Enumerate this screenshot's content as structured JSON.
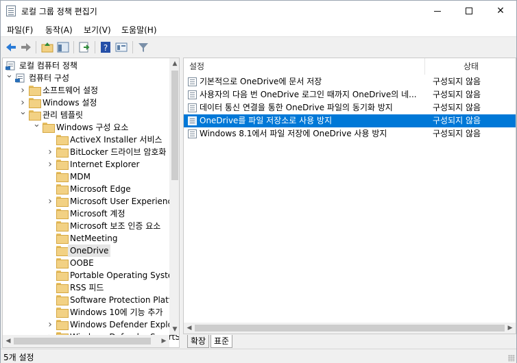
{
  "window": {
    "title": "로컬 그룹 정책 편집기"
  },
  "menu": [
    "파일(F)",
    "동작(A)",
    "보기(V)",
    "도움말(H)"
  ],
  "tree": [
    {
      "label": "로컬 컴퓨터 정책",
      "level": 0,
      "expander": "",
      "icon": "computer-policy-icon"
    },
    {
      "label": "컴퓨터 구성",
      "level": 1,
      "expander": "down",
      "icon": "computer-icon"
    },
    {
      "label": "소프트웨어 설정",
      "level": 2,
      "expander": "right",
      "icon": "folder-icon"
    },
    {
      "label": "Windows 설정",
      "level": 2,
      "expander": "right",
      "icon": "folder-icon"
    },
    {
      "label": "관리 템플릿",
      "level": 2,
      "expander": "down",
      "icon": "folder-icon"
    },
    {
      "label": "Windows 구성 요소",
      "level": 3,
      "expander": "down",
      "icon": "folder-icon"
    },
    {
      "label": "ActiveX Installer 서비스",
      "level": 4,
      "expander": "",
      "icon": "folder-icon"
    },
    {
      "label": "BitLocker 드라이브 암호화",
      "level": 4,
      "expander": "right",
      "icon": "folder-icon"
    },
    {
      "label": "Internet Explorer",
      "level": 4,
      "expander": "right",
      "icon": "folder-icon"
    },
    {
      "label": "MDM",
      "level": 4,
      "expander": "",
      "icon": "folder-icon"
    },
    {
      "label": "Microsoft Edge",
      "level": 4,
      "expander": "",
      "icon": "folder-icon"
    },
    {
      "label": "Microsoft User Experience",
      "level": 4,
      "expander": "right",
      "icon": "folder-icon"
    },
    {
      "label": "Microsoft 계정",
      "level": 4,
      "expander": "",
      "icon": "folder-icon"
    },
    {
      "label": "Microsoft 보조 인증 요소",
      "level": 4,
      "expander": "",
      "icon": "folder-icon"
    },
    {
      "label": "NetMeeting",
      "level": 4,
      "expander": "",
      "icon": "folder-icon"
    },
    {
      "label": "OneDrive",
      "level": 4,
      "expander": "",
      "icon": "folder-icon",
      "selected": true
    },
    {
      "label": "OOBE",
      "level": 4,
      "expander": "",
      "icon": "folder-icon"
    },
    {
      "label": "Portable Operating System",
      "level": 4,
      "expander": "",
      "icon": "folder-icon"
    },
    {
      "label": "RSS 피드",
      "level": 4,
      "expander": "",
      "icon": "folder-icon"
    },
    {
      "label": "Software Protection Platfo",
      "level": 4,
      "expander": "",
      "icon": "folder-icon"
    },
    {
      "label": "Windows 10에 기능 추가",
      "level": 4,
      "expander": "",
      "icon": "folder-icon"
    },
    {
      "label": "Windows Defender Exploit",
      "level": 4,
      "expander": "right",
      "icon": "folder-icon"
    },
    {
      "label": "Windows Defender SmartS",
      "level": 4,
      "expander": "right",
      "icon": "folder-icon"
    }
  ],
  "list": {
    "columns": {
      "setting": "설정",
      "state": "상태"
    },
    "rows": [
      {
        "name": "기본적으로 OneDrive에 문서 저장",
        "state": "구성되지 않음"
      },
      {
        "name": "사용자의 다음 번 OneDrive 로그인 때까지 OneDrive의 네...",
        "state": "구성되지 않음"
      },
      {
        "name": "데이터 통신 연결을 통한 OneDrive 파일의 동기화 방지",
        "state": "구성되지 않음"
      },
      {
        "name": "OneDrive를 파일 저장소로 사용 방지",
        "state": "구성되지 않음",
        "selected": true
      },
      {
        "name": "Windows 8.1에서 파일 저장에 OneDrive 사용 방지",
        "state": "구성되지 않음"
      }
    ]
  },
  "tabs": [
    "확장",
    "표준"
  ],
  "active_tab": "표준",
  "status": "5개 설정",
  "colors": {
    "selection": "#0078d7",
    "tree_selection": "#e5e5e5"
  }
}
